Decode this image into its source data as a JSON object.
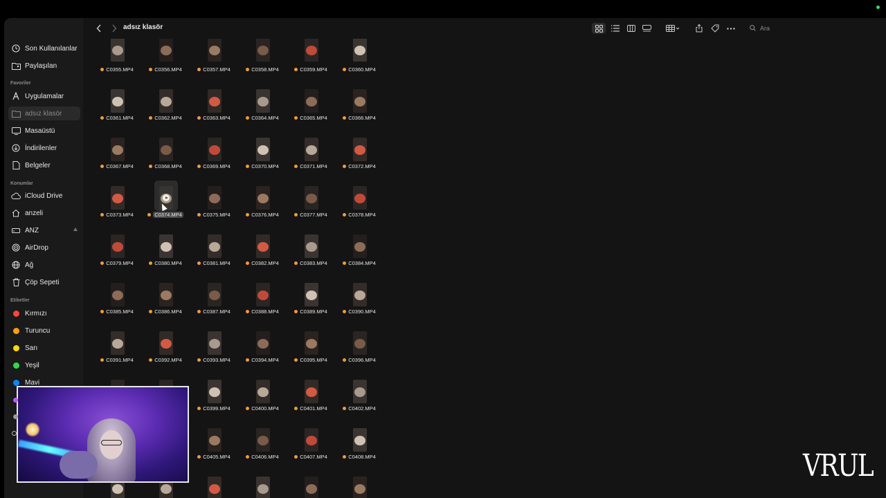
{
  "window_title": "adsız klasör",
  "search": {
    "placeholder": "Ara"
  },
  "sidebar": {
    "recent": [
      {
        "label": "Son Kullanılanlar",
        "icon": "clock-icon"
      },
      {
        "label": "Paylaşılan",
        "icon": "shared-folder-icon"
      }
    ],
    "favorites_header": "Favoriler",
    "favorites": [
      {
        "label": "Uygulamalar",
        "icon": "apps-icon"
      },
      {
        "label": "adsız klasör",
        "icon": "folder-icon",
        "selected": true
      },
      {
        "label": "Masaüstü",
        "icon": "desktop-icon"
      },
      {
        "label": "İndirilenler",
        "icon": "download-icon"
      },
      {
        "label": "Belgeler",
        "icon": "document-icon"
      }
    ],
    "locations_header": "Konumlar",
    "locations": [
      {
        "label": "iCloud Drive",
        "icon": "cloud-icon"
      },
      {
        "label": "anzeli",
        "icon": "home-icon"
      },
      {
        "label": "ANZ",
        "icon": "drive-icon",
        "ejectable": true
      },
      {
        "label": "AirDrop",
        "icon": "airdrop-icon"
      },
      {
        "label": "Ağ",
        "icon": "network-icon"
      },
      {
        "label": "Çöp Sepeti",
        "icon": "trash-icon"
      }
    ],
    "tags_header": "Etiketler",
    "tags": [
      {
        "label": "Kırmızı",
        "color": "#ff453a"
      },
      {
        "label": "Turuncu",
        "color": "#ff9f0a"
      },
      {
        "label": "Sarı",
        "color": "#ffd60a"
      },
      {
        "label": "Yeşil",
        "color": "#32d74b"
      },
      {
        "label": "Mavi",
        "color": "#0a84ff"
      }
    ]
  },
  "files": [
    [
      "C0355.MP4",
      "C0356.MP4",
      "C0357.MP4",
      "C0358.MP4",
      "C0359.MP4",
      "C0360.MP4"
    ],
    [
      "C0361.MP4",
      "C0362.MP4",
      "C0363.MP4",
      "C0364.MP4",
      "C0365.MP4",
      "C0366.MP4"
    ],
    [
      "C0367.MP4",
      "C0368.MP4",
      "C0369.MP4",
      "C0370.MP4",
      "C0371.MP4",
      "C0372.MP4"
    ],
    [
      "C0373.MP4",
      "C0374.MP4",
      "C0375.MP4",
      "C0376.MP4",
      "C0377.MP4",
      "C0378.MP4"
    ],
    [
      "C0379.MP4",
      "C0380.MP4",
      "C0381.MP4",
      "C0382.MP4",
      "C0383.MP4",
      "C0384.MP4"
    ],
    [
      "C0385.MP4",
      "C0386.MP4",
      "C0387.MP4",
      "C0388.MP4",
      "C0389.MP4",
      "C0390.MP4"
    ],
    [
      "C0391.MP4",
      "C0392.MP4",
      "C0393.MP4",
      "C0394.MP4",
      "C0395.MP4",
      "C0396.MP4"
    ],
    [
      "",
      "",
      "C0399.MP4",
      "C0400.MP4",
      "C0401.MP4",
      "C0402.MP4"
    ],
    [
      "",
      "",
      "C0405.MP4",
      "C0406.MP4",
      "C0407.MP4",
      "C0408.MP4"
    ],
    [
      "",
      "",
      "",
      "",
      "",
      ""
    ]
  ],
  "selected_file": "C0374.MP4",
  "tag_color": "#f29b38",
  "watermark": "VRUL"
}
